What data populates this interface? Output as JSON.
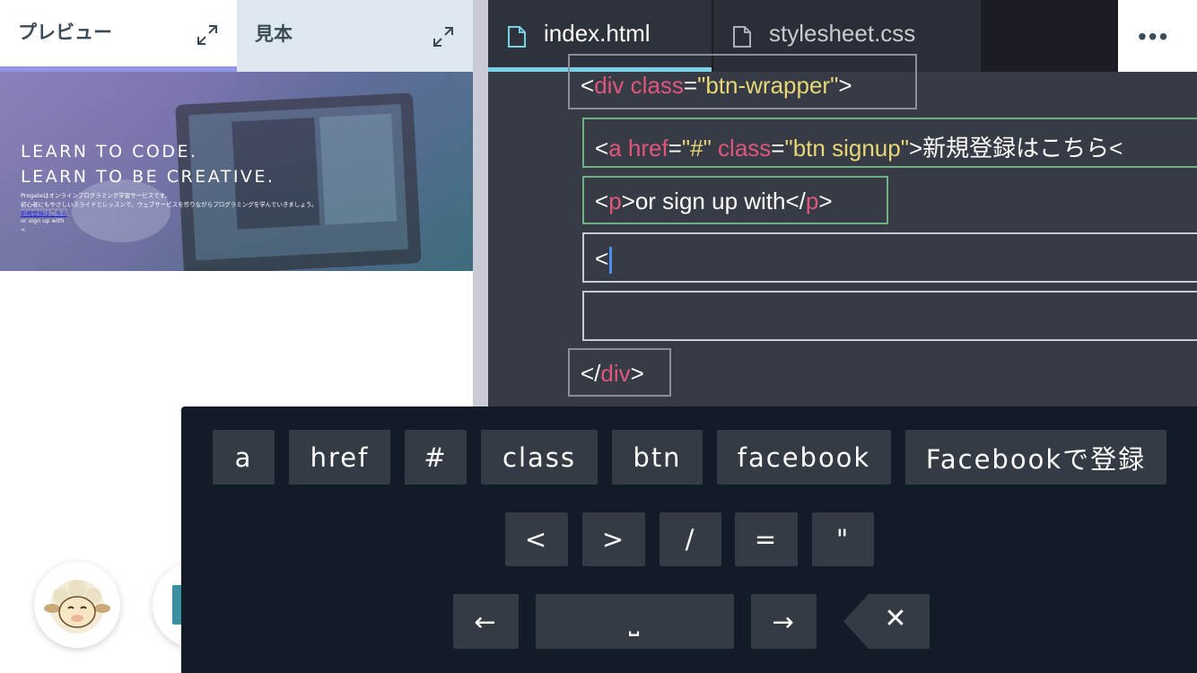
{
  "preview_panel": {
    "tabs": [
      {
        "label": "プレビュー",
        "active": true
      },
      {
        "label": "見本",
        "active": false
      }
    ],
    "hero": {
      "title_line1": "LEARN TO CODE.",
      "title_line2": "LEARN TO BE CREATIVE.",
      "small_line1": "Progateはオンラインプログラミング学習サービスです。",
      "small_line2": "初心者にもやさしいスライドとレッスンで、ウェブサービスを作りながらプログラミングを学んでいきましょう。",
      "small_link": "新規登録はこちら",
      "small_line3": "or sign up with",
      "small_line4": "<"
    }
  },
  "editor": {
    "file_tabs": [
      {
        "label": "index.html",
        "active": true
      },
      {
        "label": "stylesheet.css",
        "active": false
      }
    ],
    "more_label": "•••",
    "code": {
      "div_open": {
        "lt": "<",
        "tag": "div",
        "attr": "class",
        "eq": "=",
        "val": "\"btn-wrapper\"",
        "gt": ">"
      },
      "a_line": {
        "lt": "<",
        "tag": "a",
        "attr1": "href",
        "eq1": "=",
        "val1": "\"#\"",
        "attr2": "class",
        "eq2": "=",
        "val2": "\"btn signup\"",
        "gt": ">",
        "text": "新規登録はこちら<"
      },
      "p_line": {
        "lt": "<",
        "tag": "p",
        "gt": ">",
        "text": "or sign up with",
        "close_lt": "</",
        "close_tag": "p",
        "close_gt": ">"
      },
      "input_line": "<",
      "div_close": {
        "lt": "</",
        "tag": "div",
        "gt": ">"
      }
    }
  },
  "keyboard": {
    "row1": [
      "a",
      "href",
      "#",
      "class",
      "btn",
      "facebook",
      "Facebookで登録"
    ],
    "row2": [
      "<",
      ">",
      "/",
      "=",
      "\""
    ],
    "row3": {
      "left_arrow": "←",
      "space": "⎵",
      "right_arrow": "→",
      "backspace": "✕"
    }
  }
}
